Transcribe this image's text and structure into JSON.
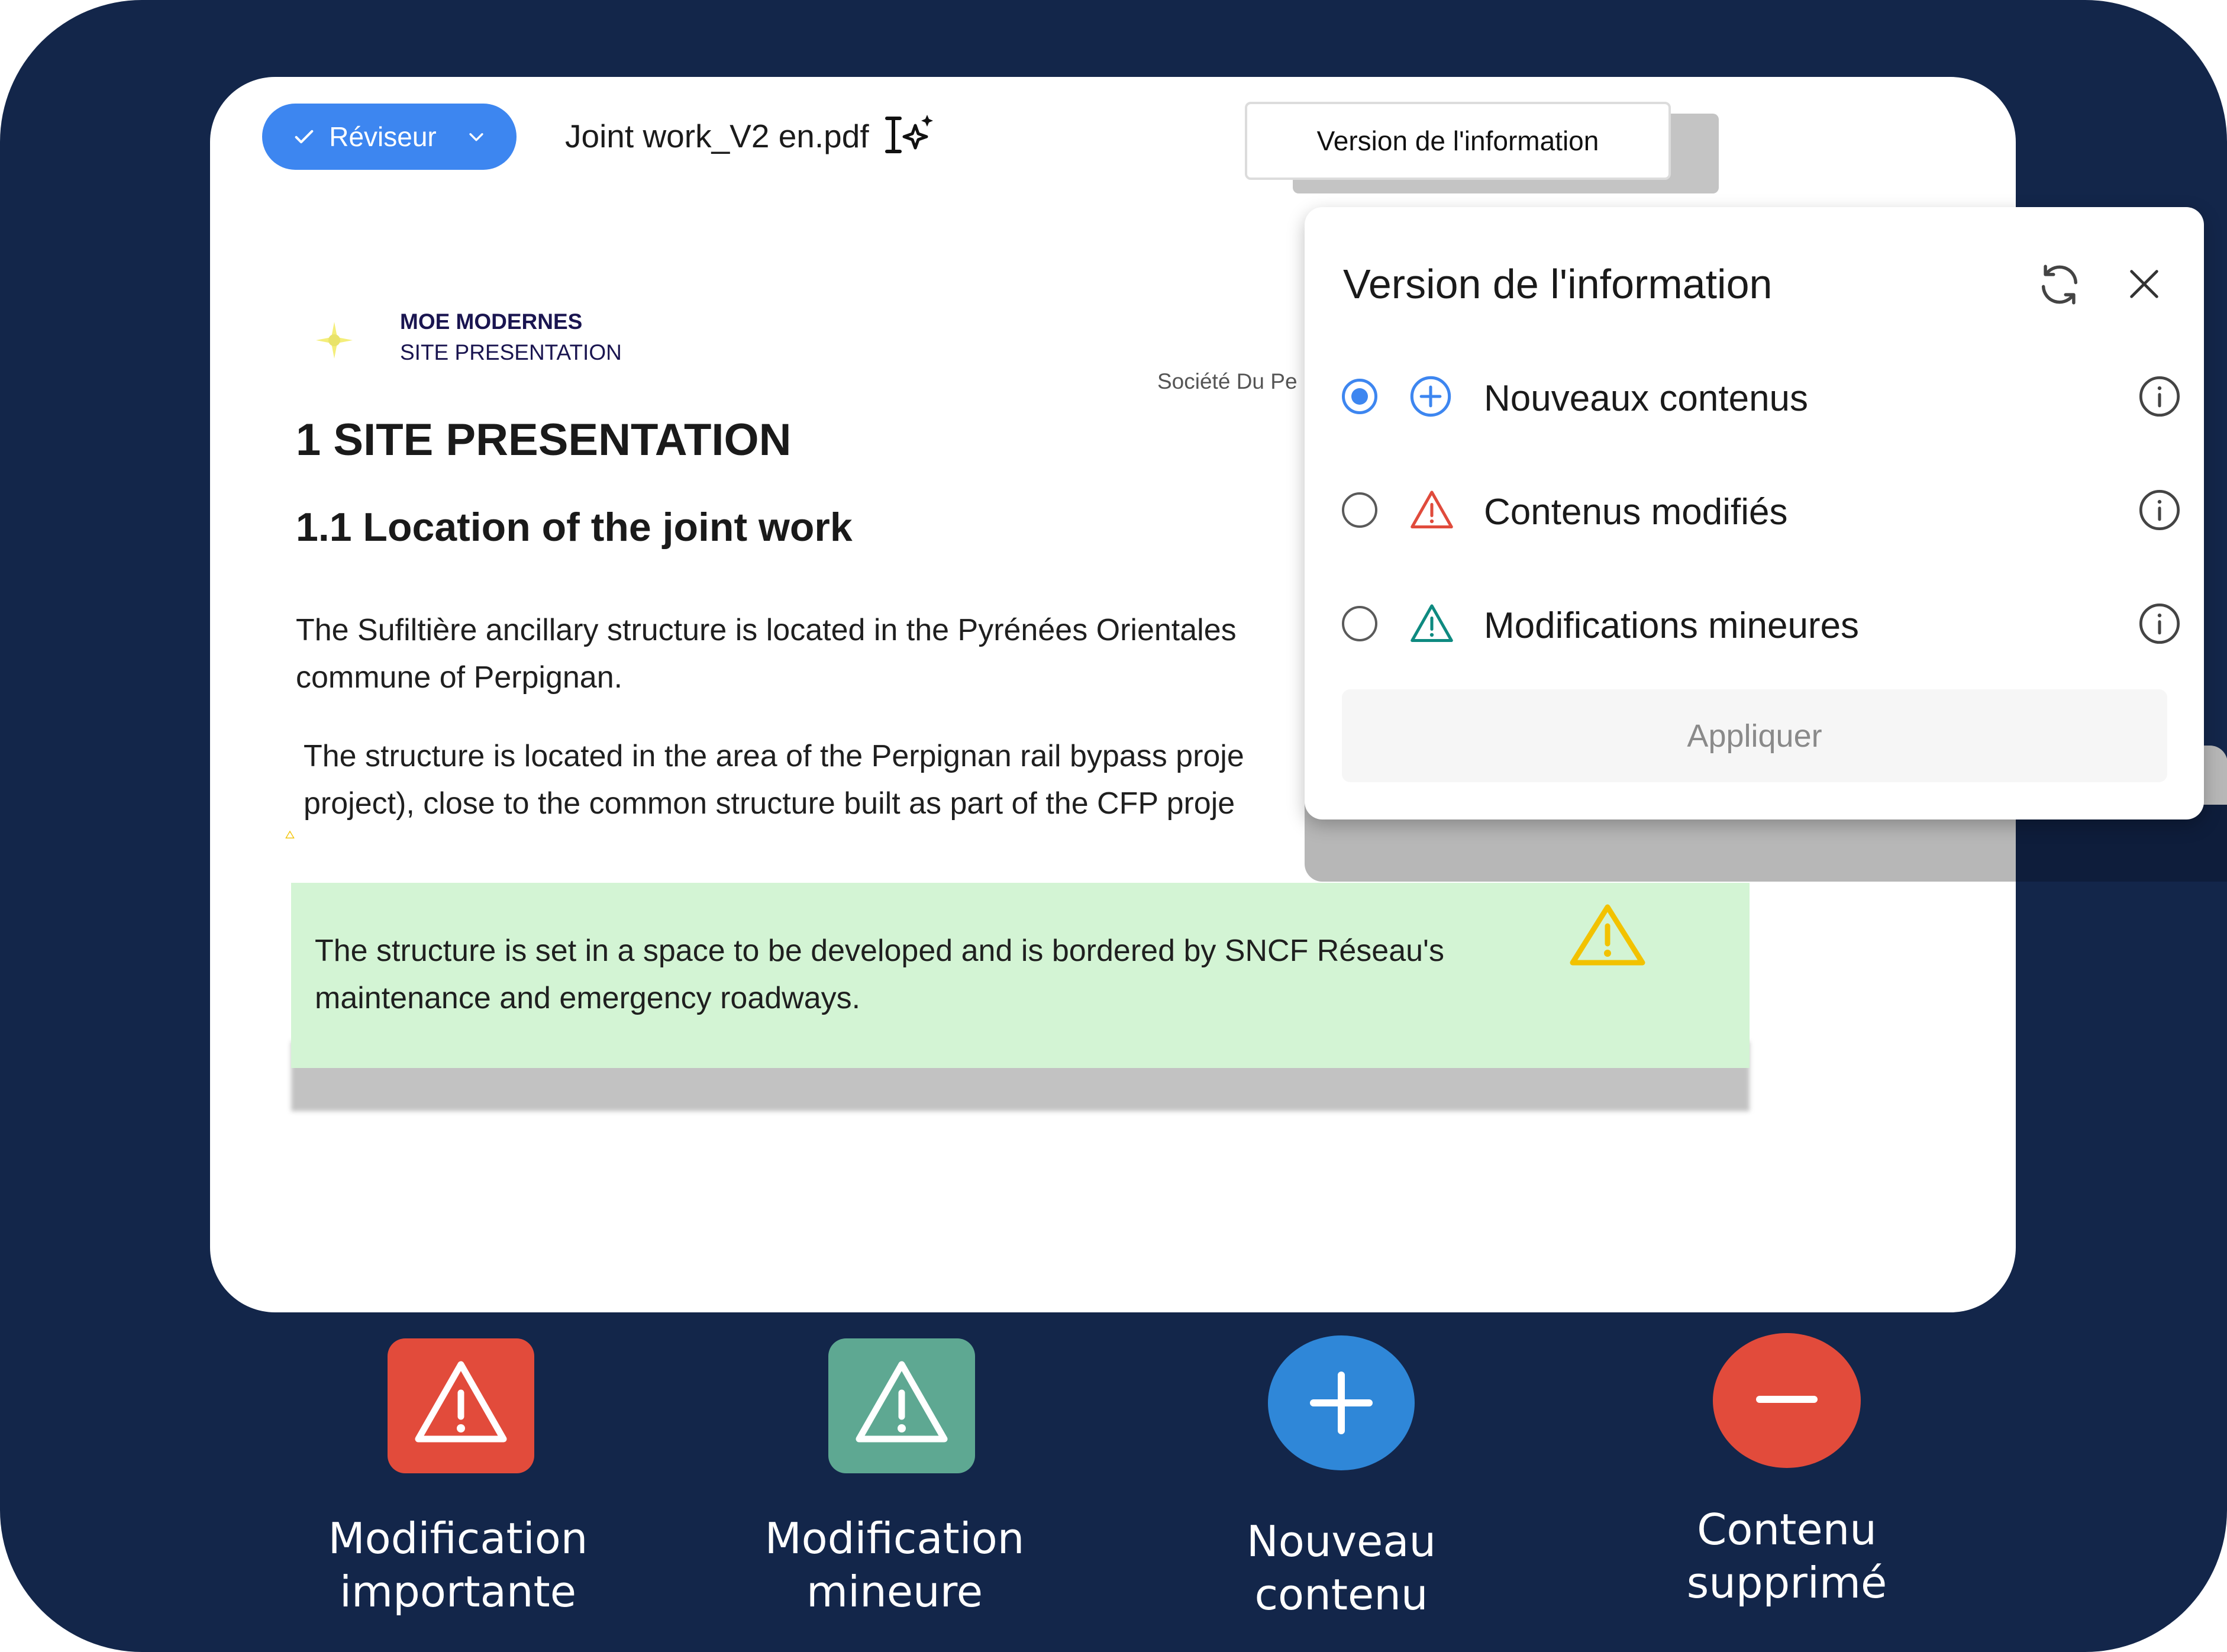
{
  "toolbar": {
    "reviewer_label": "Réviseur",
    "document_name": "Joint work_V2 en.pdf",
    "version_tab_label": "Version de l'information"
  },
  "document": {
    "brand_line_1": "MOE MODERNES",
    "brand_line_2": "SITE PRESENTATION",
    "company": "Société Du Pe",
    "heading_1": "1 SITE PRESENTATION",
    "heading_2": "1.1 Location of the joint work",
    "para_1_line_1": "The Sufiltière ancillary structure is located in the Pyrénées Orientales",
    "para_1_line_2": "commune of Perpignan.",
    "para_2_line_1": "The structure is located in the area of the Perpignan rail bypass proje",
    "para_2_line_2": "project), close to the common structure built as part of the CFP proje",
    "highlight_line_1": "The structure is set in a space to be developed and is bordered by SNCF Réseau's",
    "highlight_line_2": "maintenance and emergency roadways."
  },
  "panel": {
    "title": "Version de l'information",
    "options": [
      {
        "label": "Nouveaux contenus",
        "selected": true,
        "icon": "plus-circle-icon",
        "color": "#3d86f0"
      },
      {
        "label": "Contenus modifiés",
        "selected": false,
        "icon": "warning-icon",
        "color": "#e04b3c"
      },
      {
        "label": "Modifications mineures",
        "selected": false,
        "icon": "warning-icon",
        "color": "#0e8a80"
      }
    ],
    "apply_label": "Appliquer"
  },
  "legend": [
    {
      "line_1": "Modification",
      "line_2": "importante",
      "icon": "warning-icon",
      "color": "#e24b3b"
    },
    {
      "line_1": "Modification",
      "line_2": "mineure",
      "icon": "warning-icon",
      "color": "#5ea892"
    },
    {
      "line_1": "Nouveau",
      "line_2": "contenu",
      "icon": "plus-icon",
      "color": "#2f87d8"
    },
    {
      "line_1": "Contenu",
      "line_2": "supprimé",
      "icon": "minus-icon",
      "color": "#e24b3b"
    }
  ],
  "colors": {
    "background": "#13264a",
    "accent": "#3d86f0",
    "highlight": "#d3f4d4",
    "warning_yellow": "#f2c200"
  }
}
